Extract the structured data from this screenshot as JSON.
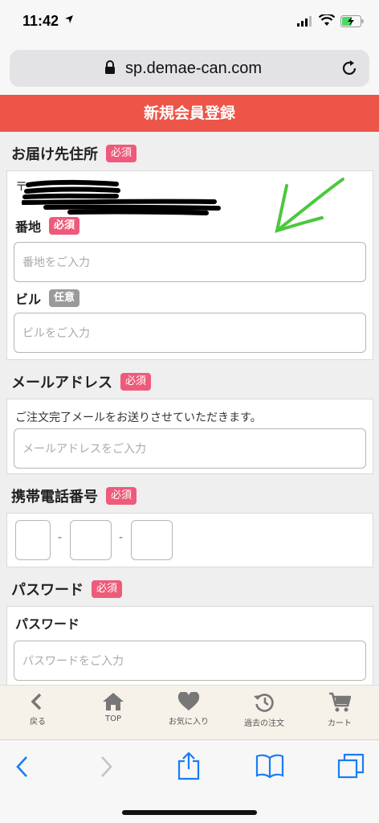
{
  "status": {
    "time": "11:42"
  },
  "browser": {
    "url": "sp.demae-can.com"
  },
  "header": {
    "title": "新規会員登録"
  },
  "address": {
    "title": "お届け先住所",
    "badge": "必須",
    "postal_mark": "〒",
    "banchi_label": "番地",
    "banchi_badge": "必須",
    "banchi_placeholder": "番地をご入力",
    "building_label": "ビル",
    "building_badge": "任意",
    "building_placeholder": "ビルをご入力"
  },
  "email": {
    "title": "メールアドレス",
    "badge": "必須",
    "note": "ご注文完了メールをお送りさせていただきます。",
    "placeholder": "メールアドレスをご入力"
  },
  "phone": {
    "title": "携帯電話番号",
    "badge": "必須",
    "separator": "-"
  },
  "password": {
    "title": "パスワード",
    "badge": "必須",
    "field_label": "パスワード",
    "placeholder": "パスワードをご入力"
  },
  "app_nav": [
    {
      "label": "戻る",
      "icon": "chevron-left-icon"
    },
    {
      "label": "TOP",
      "icon": "home-icon"
    },
    {
      "label": "お気に入り",
      "icon": "heart-icon"
    },
    {
      "label": "過去の注文",
      "icon": "history-icon"
    },
    {
      "label": "カート",
      "icon": "cart-icon"
    }
  ],
  "colors": {
    "header": "#ec5548",
    "required_badge": "#ee5b7a",
    "optional_badge": "#9a9a9a",
    "safari_blue": "#1a7cf5"
  }
}
